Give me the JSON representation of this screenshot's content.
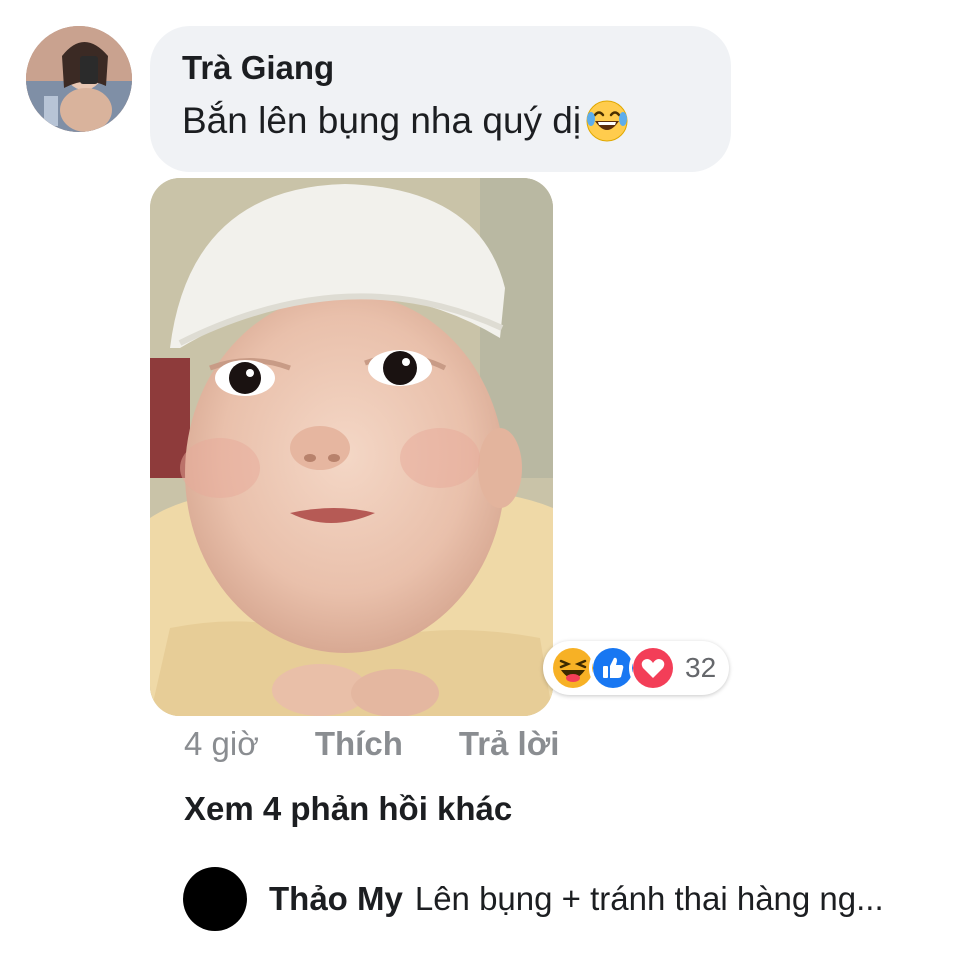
{
  "comment": {
    "author": "Trà Giang",
    "text": "Bắn lên bụng nha quý dị",
    "emoji": "tears-of-joy-emoji",
    "photo": "baby-photo",
    "reactions": {
      "icons": [
        "haha-reaction-icon",
        "like-reaction-icon",
        "love-reaction-icon"
      ],
      "count": "32"
    },
    "actions": {
      "time": "4 giờ",
      "like": "Thích",
      "reply": "Trả lời"
    }
  },
  "more_replies": "Xem 4 phản hồi khác",
  "reply": {
    "author": "Thảo My",
    "text": "Lên bụng + tránh thai hàng ng..."
  },
  "colors": {
    "bubble": "#f0f2f5",
    "text": "#1c1e21",
    "muted": "#8a8d91",
    "like_blue": "#1877f2",
    "love_red": "#f33e58",
    "haha_yellow": "#f7b125"
  }
}
